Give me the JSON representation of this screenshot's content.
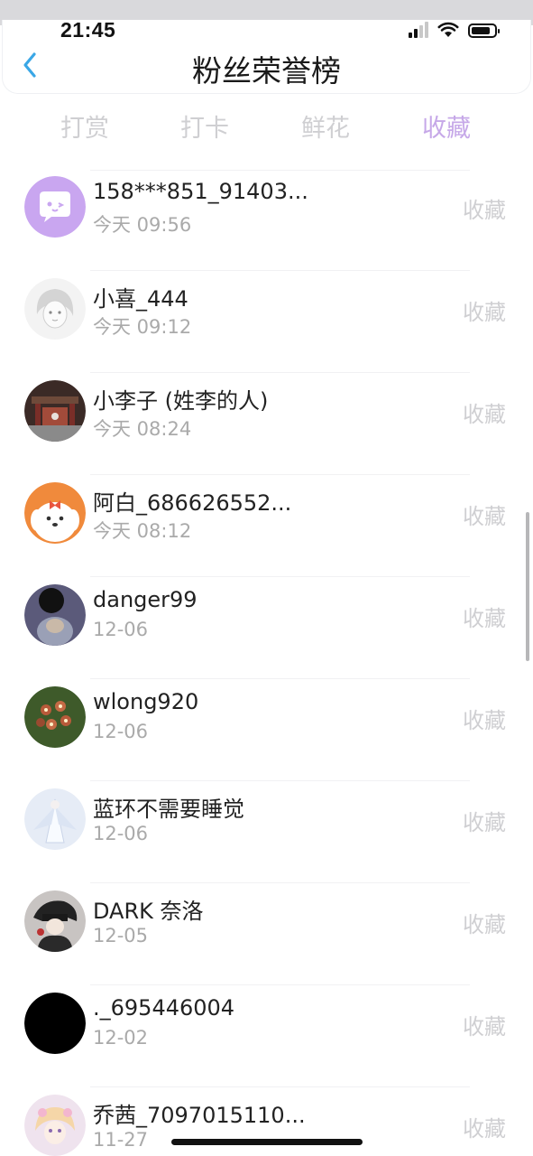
{
  "status_bar": {
    "time": "21:45"
  },
  "header": {
    "title": "粉丝荣誉榜"
  },
  "tabs": [
    {
      "label": "打赏",
      "active": false
    },
    {
      "label": "打卡",
      "active": false
    },
    {
      "label": "鲜花",
      "active": false
    },
    {
      "label": "收藏",
      "active": true
    }
  ],
  "colors": {
    "active_tab": "#c6a8e8",
    "inactive": "#cfcfd2",
    "back_arrow": "#3aa7e6"
  },
  "fans": [
    {
      "name": "158***851_91403...",
      "time": "今天 09:56",
      "action": "收藏"
    },
    {
      "name": "小喜_444",
      "time": "今天 09:12",
      "action": "收藏"
    },
    {
      "name": "小李子 (姓李的人)",
      "time": "今天 08:24",
      "action": "收藏"
    },
    {
      "name": "阿白_686626552...",
      "time": "今天 08:12",
      "action": "收藏"
    },
    {
      "name": "danger99",
      "time": "12-06",
      "action": "收藏"
    },
    {
      "name": "wlong920",
      "time": "12-06",
      "action": "收藏"
    },
    {
      "name": "蓝环不需要睡觉",
      "time": "12-06",
      "action": "收藏"
    },
    {
      "name": "DARK 奈洛",
      "time": "12-05",
      "action": "收藏"
    },
    {
      "name": "._695446004",
      "time": "12-02",
      "action": "收藏"
    },
    {
      "name": "乔茜_7097015110...",
      "time": "11-27",
      "action": "收藏"
    }
  ]
}
